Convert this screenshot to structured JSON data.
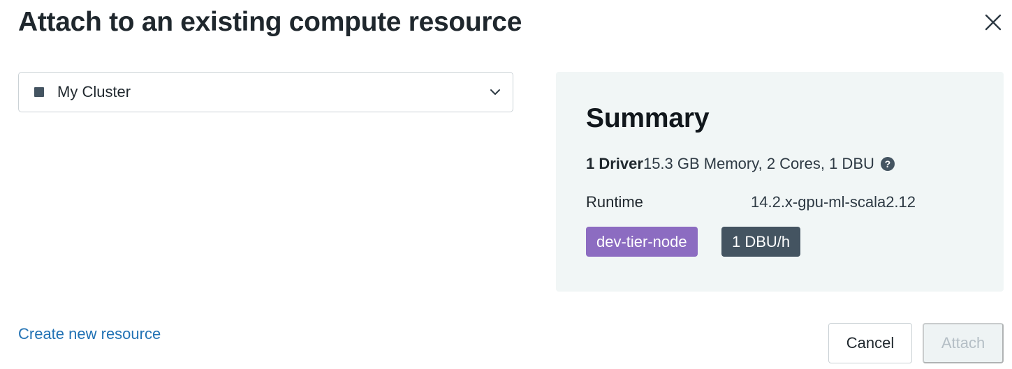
{
  "dialog": {
    "title": "Attach to an existing compute resource",
    "close_icon": "close-icon"
  },
  "resource_select": {
    "selected_value": "My Cluster",
    "status_icon": "stopped-square-icon",
    "chevron_icon": "chevron-down-icon"
  },
  "summary": {
    "title": "Summary",
    "driver_label": "1 Driver",
    "driver_detail": "15.3 GB Memory, 2 Cores, 1 DBU",
    "help_icon": "question-circle-icon",
    "help_glyph": "?",
    "runtime_label": "Runtime",
    "runtime_value": "14.2.x-gpu-ml-scala2.12",
    "tags": [
      {
        "label": "dev-tier-node",
        "color": "#8c6cc1"
      },
      {
        "label": "1 DBU/h",
        "color": "#445461"
      }
    ]
  },
  "footer": {
    "create_link": "Create new resource",
    "cancel_label": "Cancel",
    "attach_label": "Attach",
    "attach_disabled": true
  },
  "colors": {
    "link": "#2272b4",
    "summary_bg": "#f1f6f6",
    "text_primary": "#1f272d"
  }
}
